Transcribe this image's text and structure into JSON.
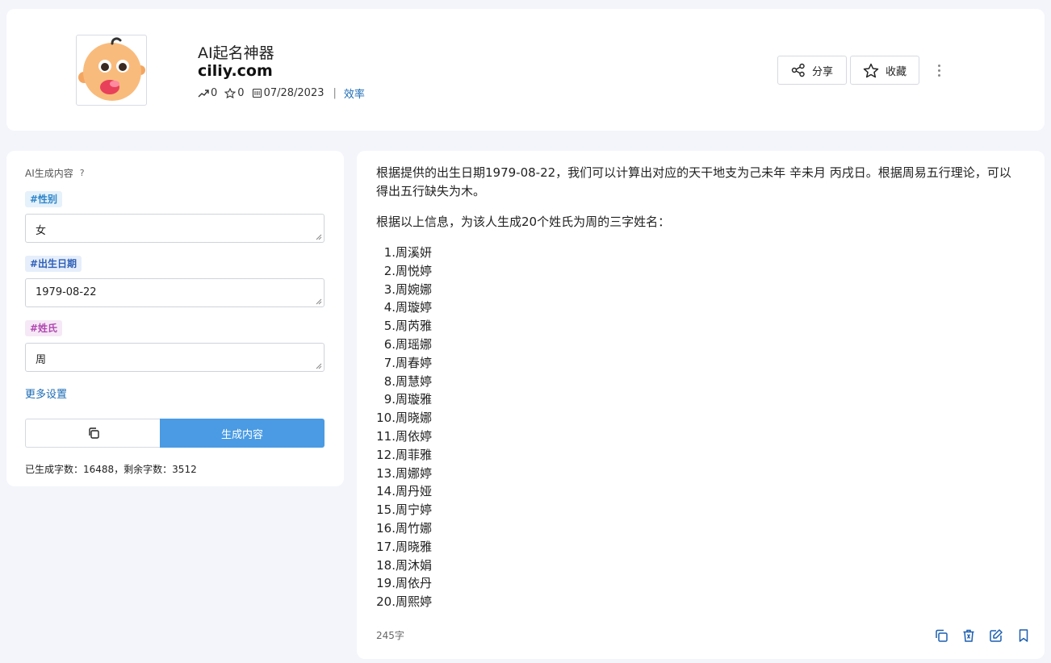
{
  "app": {
    "title": "AI起名神器",
    "domain": "ciliy.com",
    "shares": "0",
    "stars": "0",
    "date": "07/28/2023",
    "category": "效率",
    "share_label": "分享",
    "favorite_label": "收藏"
  },
  "form": {
    "section_title": "AI生成内容",
    "help": "?",
    "fields": [
      {
        "tag": "#性别",
        "value": "女"
      },
      {
        "tag": "#出生日期",
        "value": "1979-08-22"
      },
      {
        "tag": "#姓氏",
        "value": "周"
      }
    ],
    "more_settings": "更多设置",
    "generate_label": "生成内容",
    "quota": "已生成字数：16488，剩余字数：3512"
  },
  "result": {
    "intro": "根据提供的出生日期1979-08-22，我们可以计算出对应的天干地支为己未年 辛未月 丙戌日。根据周易五行理论，可以得出五行缺失为木。",
    "lead": "根据以上信息，为该人生成20个姓氏为周的三字姓名：",
    "names": [
      "周溪妍",
      "周悦婷",
      "周婉娜",
      "周璇婷",
      "周芮雅",
      "周瑶娜",
      "周春婷",
      "周慧婷",
      "周璇雅",
      "周晓娜",
      "周依婷",
      "周菲雅",
      "周娜婷",
      "周丹娅",
      "周宁婷",
      "周竹娜",
      "周晓雅",
      "周沐娟",
      "周依丹",
      "周熙婷"
    ],
    "word_count": "245字"
  },
  "colors": {
    "primary": "#4a9be3",
    "link": "#1b6bb5",
    "action_icon": "#1c5fb0"
  }
}
